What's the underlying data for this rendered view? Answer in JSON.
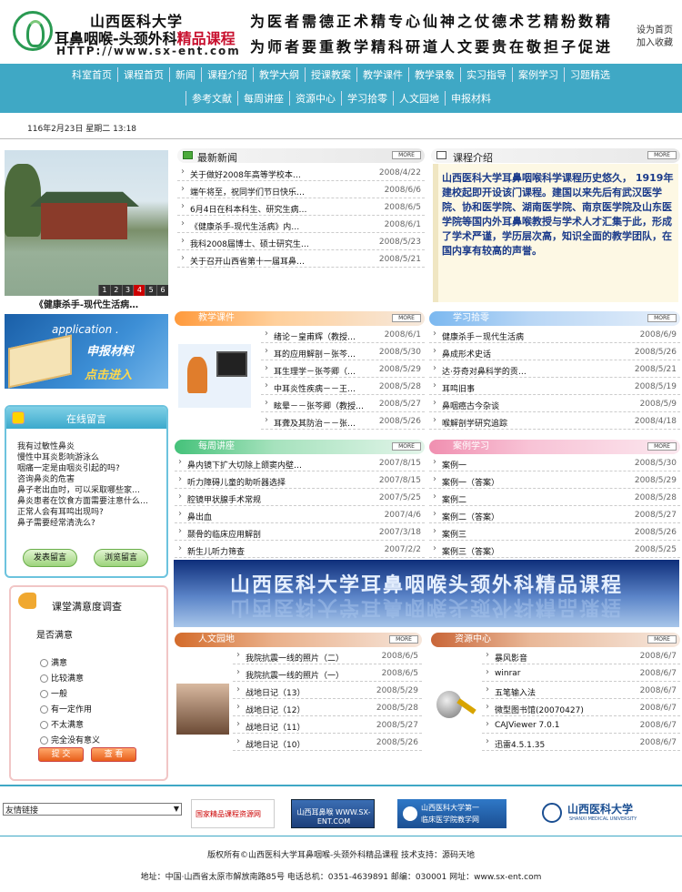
{
  "header": {
    "school": "山西医科大学",
    "course_a": "耳鼻咽喉-头颈外科",
    "course_b": "精品课程",
    "url": "HTTP://www.sx-ent.com",
    "motto1": "为医者需德正术精专心仙神之仗德术艺精粉数精",
    "motto2": "为师者要重教学精科研道人文要贵在敬担子促进",
    "set_home": "设为首页",
    "add_fav": "加入收藏"
  },
  "nav": {
    "row1": [
      "科室首页",
      "课程首页",
      "新闻",
      "课程介绍",
      "教学大纲",
      "授课教案",
      "教学课件",
      "教学录象",
      "实习指导",
      "案例学习",
      "习题精选"
    ],
    "row2": [
      "参考文献",
      "每周讲座",
      "资源中心",
      "学习拾零",
      "人文园地",
      "申报材料"
    ]
  },
  "date": "116年2月23日 星期二  13:18",
  "photo": {
    "caption": "《健康杀手-现代生活病…",
    "nums": [
      "1",
      "2",
      "3",
      "4",
      "5",
      "6"
    ]
  },
  "apply": {
    "line1": "application .",
    "line2": "申报材料",
    "line3": "点击进入"
  },
  "guestbook": {
    "title": "在线留言",
    "items": [
      "我有过敏性鼻炎",
      "慢性中耳炎影响游泳么",
      "咽痛一定是由咽炎引起的吗?",
      "咨询鼻炎的危害",
      "鼻子老出血时，可以采取哪些家…",
      "鼻炎患者在饮食方面需要注意什么…",
      "正常人会有耳鸣出现吗?",
      "鼻子需要经常清洗么?"
    ],
    "post": "发表留言",
    "browse": "浏览留言"
  },
  "survey": {
    "title": "课堂满意度调查",
    "question": "是否满意",
    "options": [
      "满意",
      "比较满意",
      "一般",
      "有一定作用",
      "不太满意",
      "完全没有意义"
    ],
    "submit": "提  交",
    "view": "查  看"
  },
  "more": "MORE",
  "news": {
    "title": "最新新闻",
    "rows": [
      {
        "t": "关于做好2008年高等学校本…",
        "d": "2008/4/22"
      },
      {
        "t": "端午将至，祝同学们节日快乐…",
        "d": "2008/6/6"
      },
      {
        "t": "6月4日在科本科生、研究生病…",
        "d": "2008/6/5"
      },
      {
        "t": "《健康杀手-现代生活病》内…",
        "d": "2008/6/1"
      },
      {
        "t": "我科2008届博士、硕士研究生…",
        "d": "2008/5/23"
      },
      {
        "t": "关于召开山西省第十一届耳鼻…",
        "d": "2008/5/21"
      }
    ]
  },
  "intro": {
    "title": "课程介绍",
    "text": "山西医科大学耳鼻咽喉科学课程历史悠久， 1919年建校起即开设该门课程。建国以来先后有武汉医学院、协和医学院、湖南医学院、南京医学院及山东医学院等国内外耳鼻喉教授与学术人才汇集于此，形成了学术严谨，学历层次高，知识全面的教学团队，在国内享有较高的声誉。"
  },
  "courseware": {
    "title": "教学课件",
    "rows": [
      {
        "t": "绪论－皇甫辉（教授…",
        "d": "2008/6/1"
      },
      {
        "t": "耳的应用解剖－张芩…",
        "d": "2008/5/30"
      },
      {
        "t": "耳生理学－张芩卿（…",
        "d": "2008/5/29"
      },
      {
        "t": "中耳炎性疾病－－王…",
        "d": "2008/5/28"
      },
      {
        "t": "眩晕－－张芩卿（教授…",
        "d": "2008/5/27"
      },
      {
        "t": "耳聋及其防治－－张…",
        "d": "2008/5/26"
      }
    ]
  },
  "study": {
    "title": "学习拾零",
    "rows": [
      {
        "t": "健康杀手－现代生活病",
        "d": "2008/6/9"
      },
      {
        "t": "鼻成形术史话",
        "d": "2008/5/26"
      },
      {
        "t": "达·芬奇对鼻科学的贡…",
        "d": "2008/5/21"
      },
      {
        "t": "耳鸣旧事",
        "d": "2008/5/19"
      },
      {
        "t": "鼻咽癌古今杂谈",
        "d": "2008/5/9"
      },
      {
        "t": "喉解剖学研究追踪",
        "d": "2008/4/18"
      }
    ]
  },
  "lecture": {
    "title": "每周讲座",
    "rows": [
      {
        "t": "鼻内镜下扩大切除上颌窦内壁…",
        "d": "2007/8/15"
      },
      {
        "t": "听力障碍儿童的助听器选择",
        "d": "2007/8/15"
      },
      {
        "t": "腔镜甲状腺手术常规",
        "d": "2007/5/25"
      },
      {
        "t": "鼻出血",
        "d": "2007/4/6"
      },
      {
        "t": "颞骨的临床应用解剖",
        "d": "2007/3/18"
      },
      {
        "t": "新生儿听力筛查",
        "d": "2007/2/2"
      }
    ]
  },
  "cases": {
    "title": "案例学习",
    "rows": [
      {
        "t": "案例一",
        "d": "2008/5/30"
      },
      {
        "t": "案例一（答案）",
        "d": "2008/5/29"
      },
      {
        "t": "案例二",
        "d": "2008/5/28"
      },
      {
        "t": "案例二（答案）",
        "d": "2008/5/27"
      },
      {
        "t": "案例三",
        "d": "2008/5/26"
      },
      {
        "t": "案例三（答案）",
        "d": "2008/5/25"
      }
    ]
  },
  "banner": "山西医科大学耳鼻咽喉头颈外科精品课程",
  "humanities": {
    "title": "人文园地",
    "rows": [
      {
        "t": "我院抗震一线的照片（二）",
        "d": "2008/6/5"
      },
      {
        "t": "我院抗震一线的照片（一）",
        "d": "2008/6/5"
      },
      {
        "t": "战地日记（13）",
        "d": "2008/5/29"
      },
      {
        "t": "战地日记（12）",
        "d": "2008/5/28"
      },
      {
        "t": "战地日记（11）",
        "d": "2008/5/27"
      },
      {
        "t": "战地日记（10）",
        "d": "2008/5/26"
      }
    ]
  },
  "resources": {
    "title": "资源中心",
    "rows": [
      {
        "t": "暴风影音",
        "d": "2008/6/7"
      },
      {
        "t": "winrar",
        "d": "2008/6/7"
      },
      {
        "t": "五笔输入法",
        "d": "2008/6/7"
      },
      {
        "t": "微型图书馆(20070427)",
        "d": "2008/6/7"
      },
      {
        "t": "CAJViewer 7.0.1",
        "d": "2008/6/7"
      },
      {
        "t": "迅雷4.5.1.35",
        "d": "2008/6/7"
      }
    ]
  },
  "links": {
    "select": "友情链接",
    "logo1": "国家精品课程资源网",
    "logo2": "山西耳鼻喉 WWW.SX-ENT.COM",
    "logo3_a": "山西医科大学第一",
    "logo3_b": "临床医学院教学网",
    "logo4": "山西医科大学",
    "logo4_en": "SHANXI MEDICAL UNIVERSITY"
  },
  "footer": {
    "copyright": "版权所有©山西医科大学耳鼻咽喉-头颈外科精品课程 技术支持：源码天地",
    "address": "地址：中国·山西省太原市解放南路85号  电话总机：0351-4639891  邮编：030001  网址：www.sx-ent.com"
  }
}
